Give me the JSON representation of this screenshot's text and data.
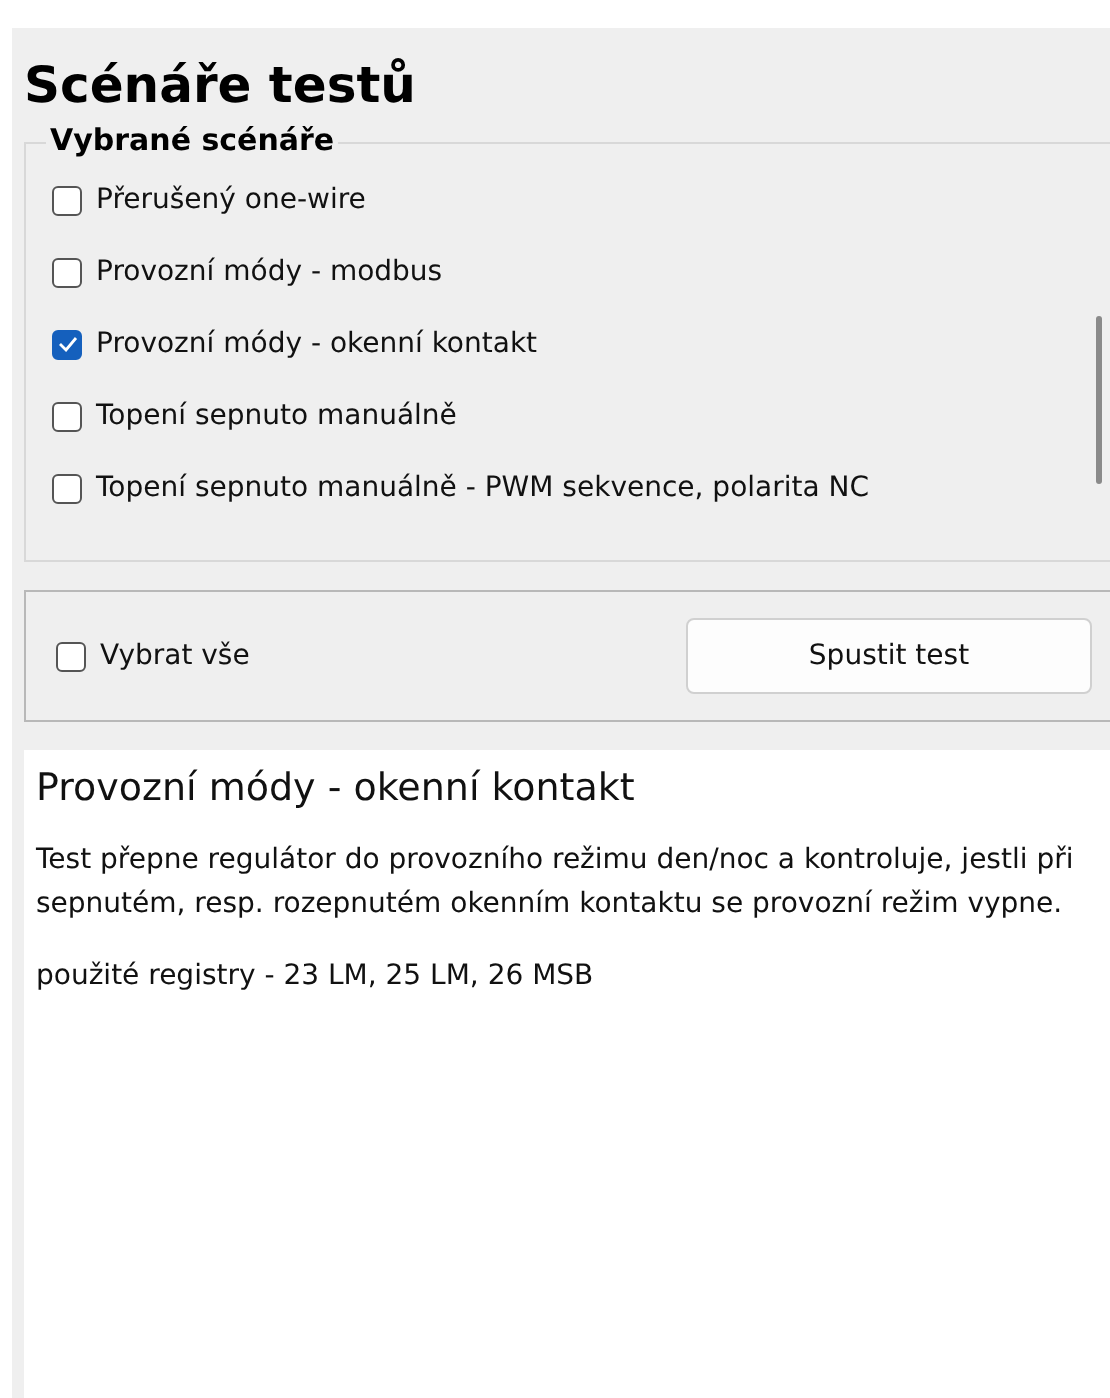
{
  "title": "Scénáře testů",
  "group": {
    "label": "Vybrané scénáře",
    "items": [
      {
        "label": "Přerušený one-wire",
        "checked": false
      },
      {
        "label": "Provozní módy - modbus",
        "checked": false
      },
      {
        "label": "Provozní módy - okenní kontakt",
        "checked": true
      },
      {
        "label": "Topení sepnuto manuálně",
        "checked": false
      },
      {
        "label": "Topení sepnuto manuálně - PWM sekvence, polarita NC",
        "checked": false
      }
    ]
  },
  "select_all": {
    "label": "Vybrat vše",
    "checked": false
  },
  "run_button": "Spustit test",
  "detail": {
    "heading": "Provozní módy - okenní kontakt",
    "paragraphs": [
      "Test přepne regulátor do provozního režimu den/noc a kontroluje, jestli při sepnutém, resp. rozepnutém okenním kontaktu se provozní režim vypne.",
      "použité registry - 23 LM, 25 LM, 26 MSB"
    ]
  }
}
